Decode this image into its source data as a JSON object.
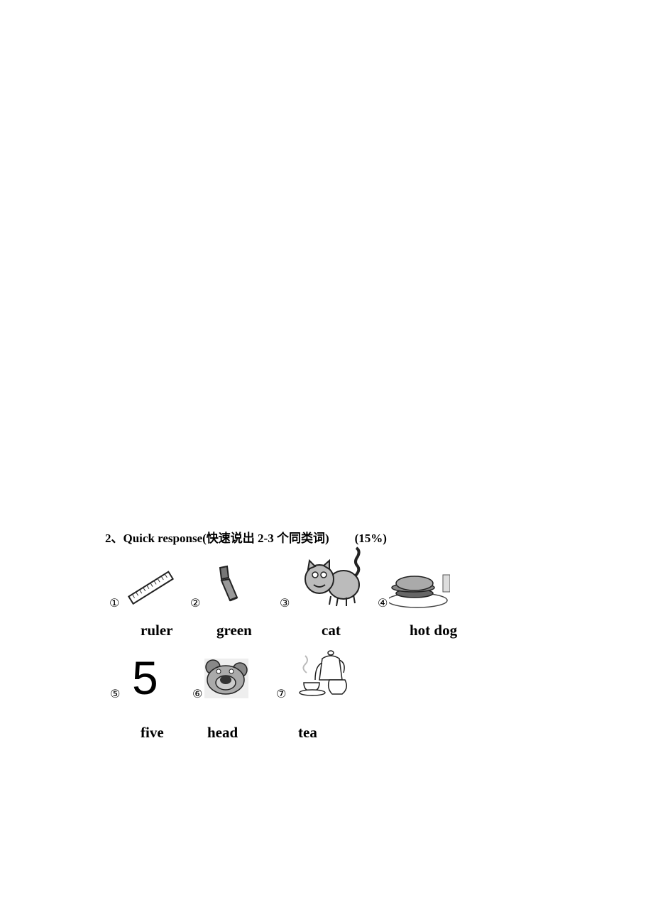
{
  "section": {
    "heading": "2、Quick response(快速说出 2-3 个同类词)",
    "score": "(15%)"
  },
  "items": [
    {
      "number": "①",
      "picture": "ruler-icon",
      "word": "ruler"
    },
    {
      "number": "②",
      "picture": "paint-tube-icon",
      "word": "green"
    },
    {
      "number": "③",
      "picture": "cat-icon",
      "word": "cat"
    },
    {
      "number": "④",
      "picture": "hot-dog-icon",
      "word": "hot dog"
    },
    {
      "number": "⑤",
      "picture": "number-five",
      "glyph": "5",
      "word": "five"
    },
    {
      "number": "⑥",
      "picture": "bear-head-icon",
      "word": "head"
    },
    {
      "number": "⑦",
      "picture": "teapot-icon",
      "word": "tea"
    }
  ]
}
